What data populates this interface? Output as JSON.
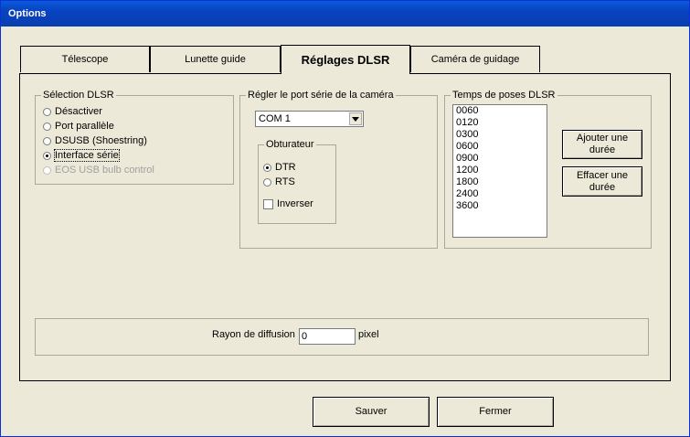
{
  "window": {
    "title": "Options"
  },
  "tabs": [
    {
      "label": "Télescope"
    },
    {
      "label": "Lunette guide"
    },
    {
      "label": "Réglages DLSR",
      "active": true
    },
    {
      "label": "Caméra de guidage"
    }
  ],
  "dslr_selection": {
    "legend": "Sélection DLSR",
    "options": [
      {
        "label": "Désactiver",
        "selected": false,
        "enabled": true
      },
      {
        "label": "Port parallèle",
        "selected": false,
        "enabled": true
      },
      {
        "label": "DSUSB (Shoestring)",
        "selected": false,
        "enabled": true
      },
      {
        "label": "Interface série",
        "selected": true,
        "enabled": true
      },
      {
        "label": "EOS USB bulb control",
        "selected": false,
        "enabled": false
      }
    ]
  },
  "serial_port": {
    "legend": "Régler le port série de la caméra",
    "combo_value": "COM 1",
    "shutter": {
      "legend": "Obturateur",
      "options": [
        {
          "label": "DTR",
          "selected": true
        },
        {
          "label": "RTS",
          "selected": false
        }
      ],
      "invert_label": "Inverser",
      "invert_checked": false
    }
  },
  "exposure_times": {
    "legend": "Temps de poses DLSR",
    "items": [
      "0060",
      "0120",
      "0300",
      "0600",
      "0900",
      "1200",
      "1800",
      "2400",
      "3600"
    ],
    "add_button": "Ajouter une durée",
    "delete_button": "Effacer une durée"
  },
  "diffusion": {
    "label": "Rayon de diffusion :",
    "value": "0",
    "unit": "pixel"
  },
  "footer": {
    "save": "Sauver",
    "close": "Fermer"
  }
}
